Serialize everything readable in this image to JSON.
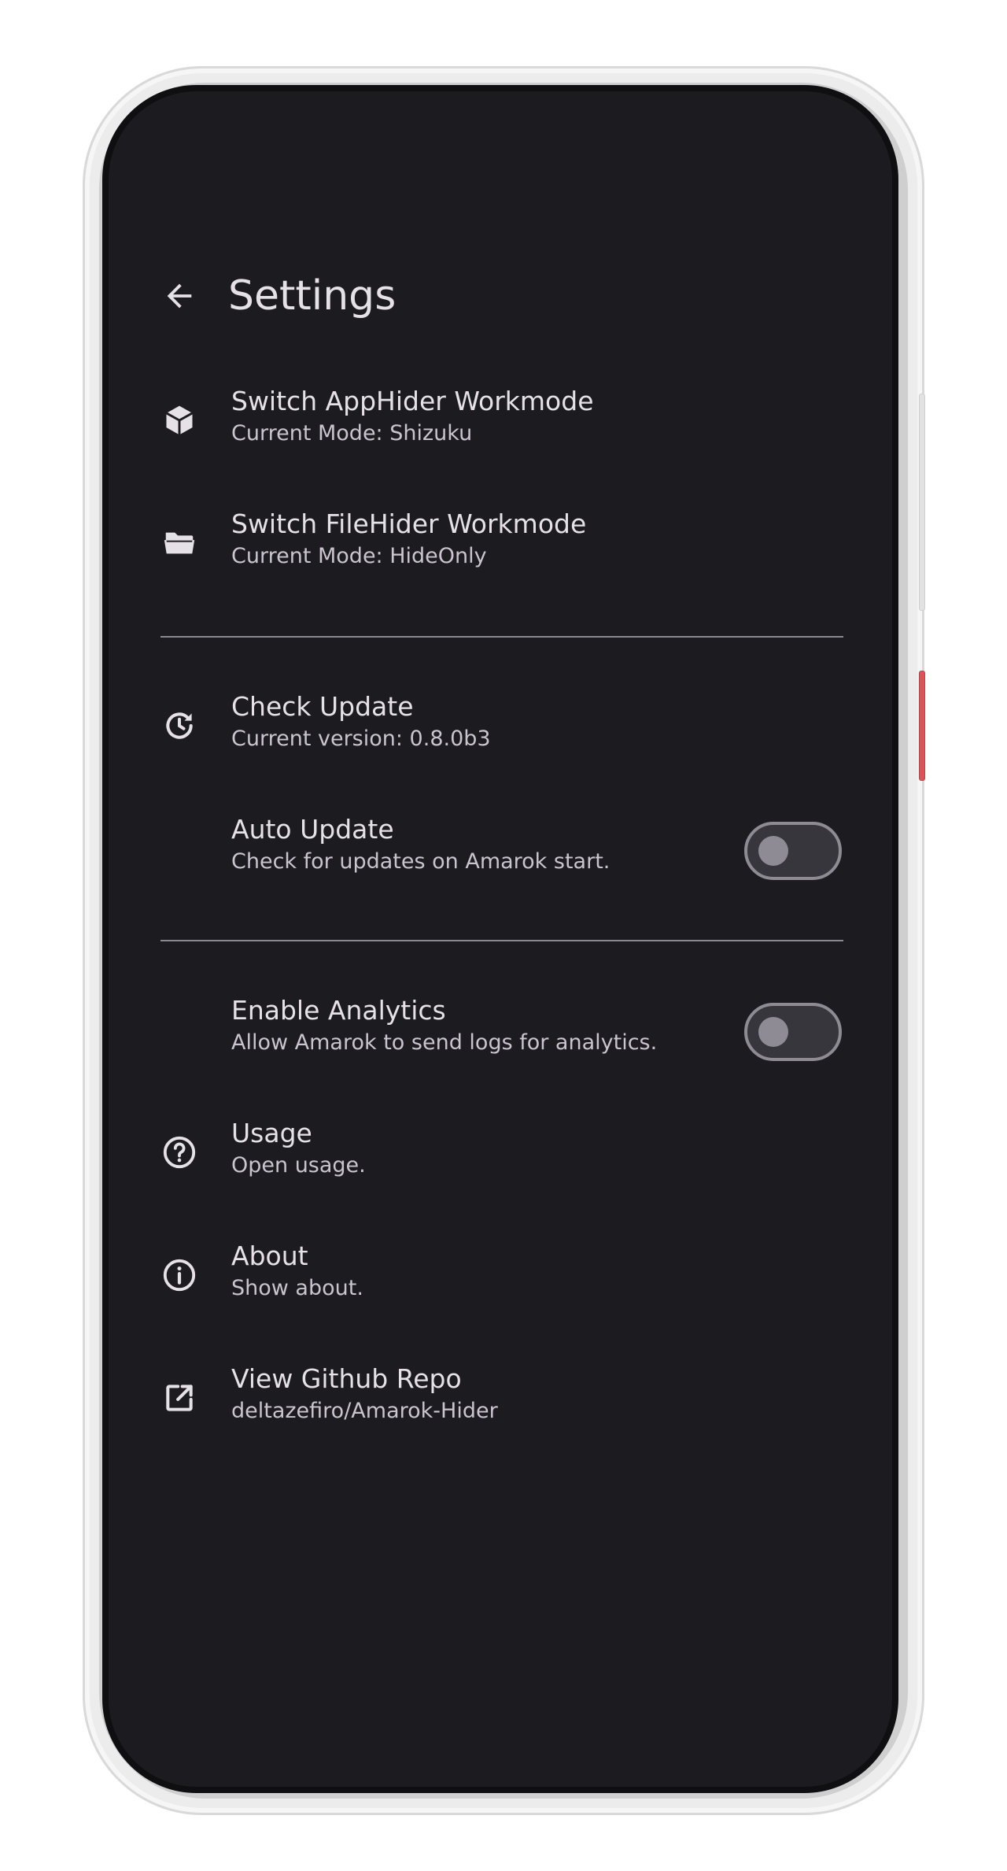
{
  "app_bar": {
    "back_icon": "arrow-back-icon",
    "title": "Settings"
  },
  "settings": {
    "apphider": {
      "icon": "cube-icon",
      "title": "Switch AppHider Workmode",
      "subtitle": "Current Mode: Shizuku"
    },
    "filehider": {
      "icon": "folder-open-icon",
      "title": "Switch FileHider Workmode",
      "subtitle": "Current Mode: HideOnly"
    },
    "check_update": {
      "icon": "update-icon",
      "title": "Check Update",
      "subtitle": "Current version: 0.8.0b3"
    },
    "auto_update": {
      "title": "Auto Update",
      "subtitle": "Check for updates on Amarok start.",
      "enabled": false
    },
    "analytics": {
      "title": "Enable Analytics",
      "subtitle": "Allow Amarok to send logs for analytics.",
      "enabled": false
    },
    "usage": {
      "icon": "help-circle-icon",
      "title": "Usage",
      "subtitle": "Open usage."
    },
    "about": {
      "icon": "info-circle-icon",
      "title": "About",
      "subtitle": "Show about."
    },
    "github": {
      "icon": "open-in-new-icon",
      "title": "View Github Repo",
      "subtitle": "deltazefiro/Amarok-Hider"
    }
  },
  "colors": {
    "background": "#1c1b20",
    "text_primary": "#e6e1e6",
    "text_secondary": "#cac4cf",
    "divider": "#8c8990",
    "switch_off_track": "#37363d",
    "switch_off_outline": "#8e8b94"
  }
}
